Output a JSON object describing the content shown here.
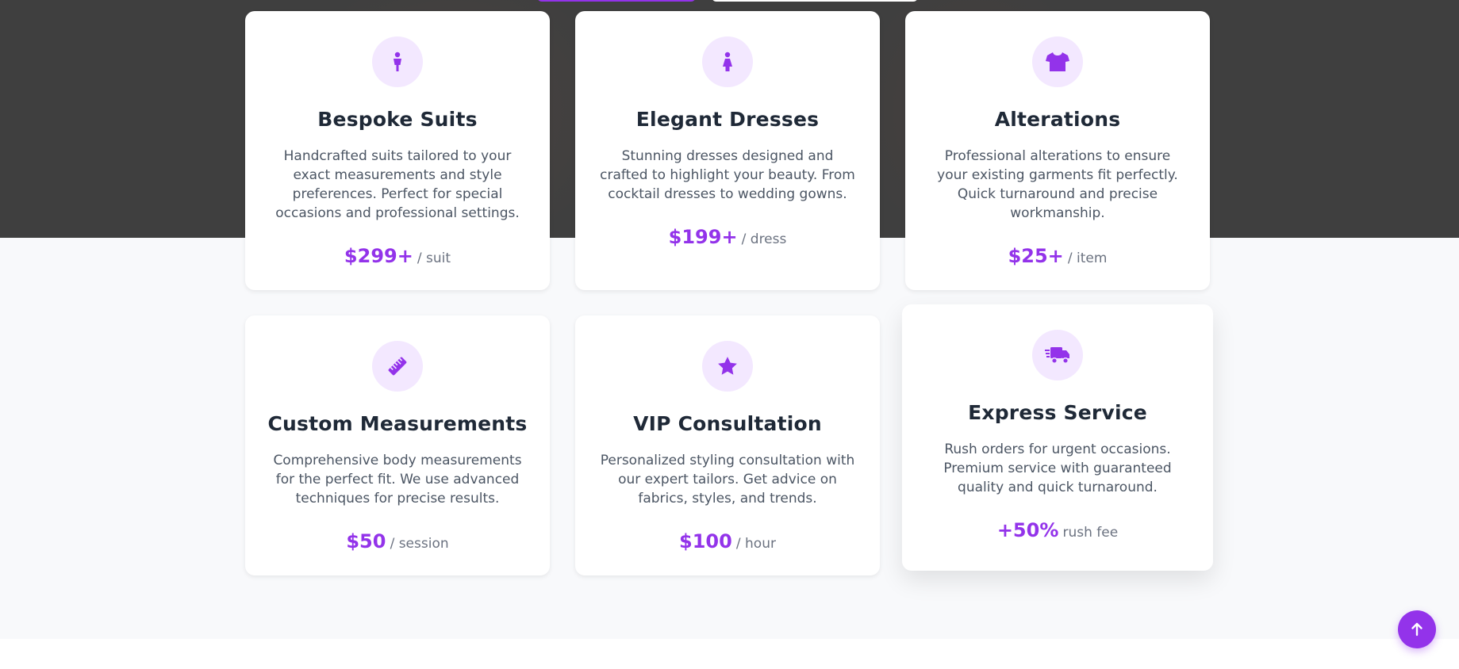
{
  "accent_color": "#9333ea",
  "icon_bg_color": "#f3e8ff",
  "services": [
    {
      "icon": "person-icon",
      "title": "Bespoke Suits",
      "description": "Handcrafted suits tailored to your exact measurements and style preferences. Perfect for special occasions and professional settings.",
      "price": "$299+",
      "unit": "/ suit"
    },
    {
      "icon": "dress-person-icon",
      "title": "Elegant Dresses",
      "description": "Stunning dresses designed and crafted to highlight your beauty. From cocktail dresses to wedding gowns.",
      "price": "$199+",
      "unit": "/ dress"
    },
    {
      "icon": "shirt-icon",
      "title": "Alterations",
      "description": "Professional alterations to ensure your existing garments fit perfectly. Quick turnaround and precise workmanship.",
      "price": "$25+",
      "unit": "/ item"
    },
    {
      "icon": "ruler-icon",
      "title": "Custom Measurements",
      "description": "Comprehensive body measurements for the perfect fit. We use advanced techniques for precise results.",
      "price": "$50",
      "unit": "/ session"
    },
    {
      "icon": "star-icon",
      "title": "VIP Consultation",
      "description": "Personalized styling consultation with our expert tailors. Get advice on fabrics, styles, and trends.",
      "price": "$100",
      "unit": "/ hour"
    },
    {
      "icon": "shipping-fast-icon",
      "title": "Express Service",
      "description": "Rush orders for urgent occasions. Premium service with guaranteed quality and quick turnaround.",
      "price": "+50%",
      "unit": "rush fee"
    }
  ],
  "scroll_top": {
    "icon": "arrow-up-icon"
  }
}
